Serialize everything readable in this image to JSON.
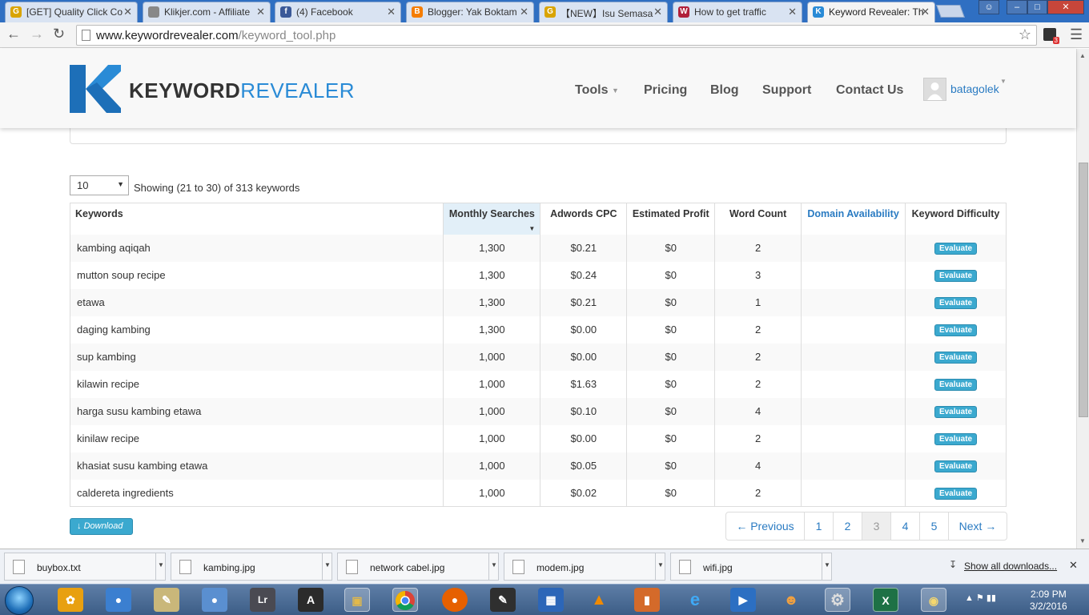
{
  "browser": {
    "tabs": [
      {
        "title": "[GET] Quality Click Co",
        "color": "#d9a400",
        "glyph": "G"
      },
      {
        "title": "Klikjer.com - Affiliate",
        "color": "#888888",
        "glyph": ""
      },
      {
        "title": "(4) Facebook",
        "color": "#3b5998",
        "glyph": "f"
      },
      {
        "title": "Blogger: Yak Boktam",
        "color": "#f57d00",
        "glyph": "B"
      },
      {
        "title": "【NEW】Isu Semasa",
        "color": "#d9a400",
        "glyph": "G"
      },
      {
        "title": "How to get traffic",
        "color": "#b0203a",
        "glyph": "W"
      },
      {
        "title": "Keyword Revealer: Th",
        "color": "#2a8bd6",
        "glyph": "K"
      }
    ],
    "url_host": "www.keywordrevealer.com",
    "url_path": "/keyword_tool.php",
    "extension_badge": "3"
  },
  "site": {
    "logo_bold": "KEYWORD",
    "logo_light": "REVEALER",
    "nav": {
      "tools": "Tools",
      "pricing": "Pricing",
      "blog": "Blog",
      "support": "Support",
      "contact": "Contact Us"
    },
    "username": "batagolek"
  },
  "results": {
    "per_page": "10",
    "showing": "Showing (21 to 30) of 313 keywords",
    "headers": [
      "Keywords",
      "Monthly Searches",
      "Adwords CPC",
      "Estimated Profit",
      "Word Count",
      "Domain Availability",
      "Keyword Difficulty"
    ],
    "evaluate_label": "Evaluate",
    "rows": [
      {
        "keyword": "kambing aqiqah",
        "searches": "1,300",
        "cpc": "$0.21",
        "profit": "$0",
        "words": "2"
      },
      {
        "keyword": "mutton soup recipe",
        "searches": "1,300",
        "cpc": "$0.24",
        "profit": "$0",
        "words": "3"
      },
      {
        "keyword": "etawa",
        "searches": "1,300",
        "cpc": "$0.21",
        "profit": "$0",
        "words": "1"
      },
      {
        "keyword": "daging kambing",
        "searches": "1,300",
        "cpc": "$0.00",
        "profit": "$0",
        "words": "2"
      },
      {
        "keyword": "sup kambing",
        "searches": "1,000",
        "cpc": "$0.00",
        "profit": "$0",
        "words": "2"
      },
      {
        "keyword": "kilawin recipe",
        "searches": "1,000",
        "cpc": "$1.63",
        "profit": "$0",
        "words": "2"
      },
      {
        "keyword": "harga susu kambing etawa",
        "searches": "1,000",
        "cpc": "$0.10",
        "profit": "$0",
        "words": "4"
      },
      {
        "keyword": "kinilaw recipe",
        "searches": "1,000",
        "cpc": "$0.00",
        "profit": "$0",
        "words": "2"
      },
      {
        "keyword": "khasiat susu kambing etawa",
        "searches": "1,000",
        "cpc": "$0.05",
        "profit": "$0",
        "words": "4"
      },
      {
        "keyword": "caldereta ingredients",
        "searches": "1,000",
        "cpc": "$0.02",
        "profit": "$0",
        "words": "2"
      }
    ],
    "download_label": "Download",
    "pagination": {
      "previous": "← Previous",
      "pages": [
        "1",
        "2",
        "3",
        "4",
        "5"
      ],
      "current": "3",
      "next": "Next →"
    }
  },
  "downloads": {
    "items": [
      "buybox.txt",
      "kambing.jpg",
      "network cabel.jpg",
      "modem.jpg",
      "wifi.jpg"
    ],
    "show_all": "Show all downloads..."
  },
  "taskbar": {
    "time": "2:09 PM",
    "date": "3/2/2016"
  }
}
